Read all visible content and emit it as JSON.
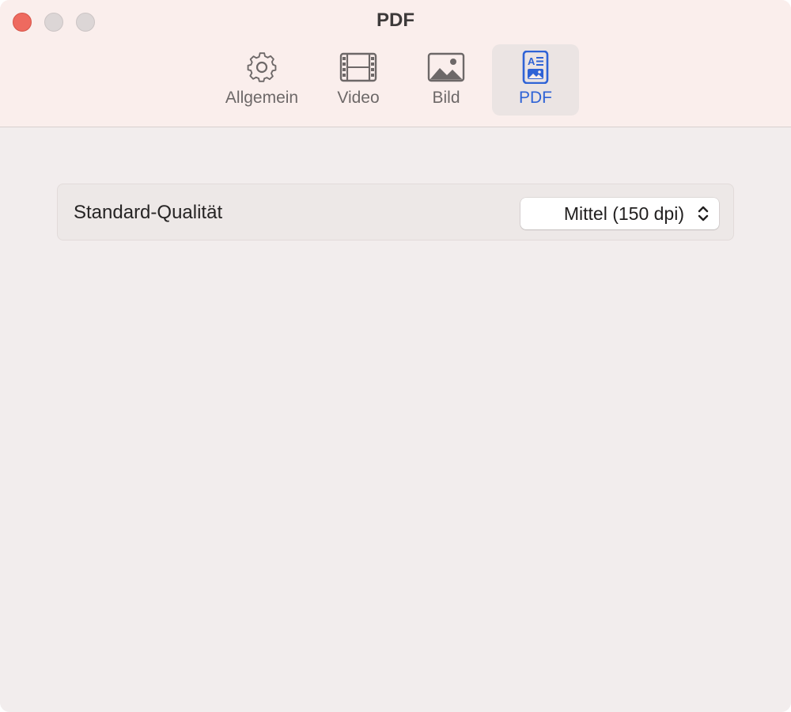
{
  "window": {
    "title": "PDF",
    "buttons": {
      "close": "close",
      "minimize": "minimize",
      "zoom": "zoom"
    }
  },
  "toolbar": {
    "tabs": [
      {
        "label": "Allgemein",
        "icon": "gear-icon",
        "active": false
      },
      {
        "label": "Video",
        "icon": "film-icon",
        "active": false
      },
      {
        "label": "Bild",
        "icon": "image-icon",
        "active": false
      },
      {
        "label": "PDF",
        "icon": "pdf-document-icon",
        "active": true
      }
    ]
  },
  "settings": {
    "quality_label": "Standard-Qualität",
    "quality_value": "Mittel (150 dpi)"
  },
  "colors": {
    "accent": "#2f63d6",
    "close_button": "#ee6a5f",
    "toolbar_background": "#faeeec",
    "content_background": "#f2eded"
  }
}
